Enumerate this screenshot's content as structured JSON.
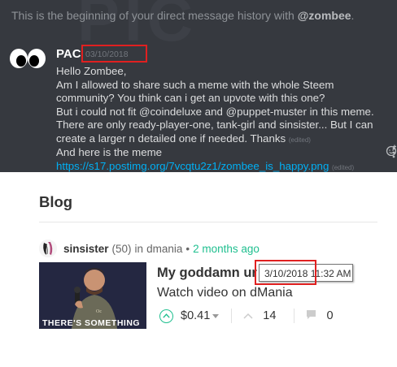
{
  "chat": {
    "intro_prefix": "This is the beginning of your direct message history with ",
    "intro_user": "@zombee",
    "intro_suffix": ".",
    "background_text": "PIC",
    "author": "PAC",
    "timestamp": "03/10/2018",
    "message_lines": [
      "Hello Zombee,",
      "Am I allowed to share such a meme with the whole Steem",
      "community? You think can i get an upvote with this one?",
      "But i could not fit @coindeluxe and @puppet-muster in this meme.",
      "There are only ready-player-one, tank-girl and sinsister... But I can",
      "create a larger n detailed one if needed. Thanks "
    ],
    "edited_label": "(edited)",
    "message2_text": "And here is the meme",
    "link": "https://s17.postimg.org/7vcqtu2z1/zombee_is_happy.png",
    "edited_label_2": "(edited)"
  },
  "blog": {
    "heading": "Blog",
    "post": {
      "author": "sinsister",
      "reputation": "(50)",
      "in_word": "in",
      "category": "dmania",
      "separator": "•",
      "time_ago": "2 months ago",
      "title": "My goddamn ur",
      "body": "Watch video on dMania",
      "thumbnail_caption": "THERE'S SOMETHING",
      "payout": "$0.41",
      "votes": "14",
      "comments": "0"
    },
    "tooltip": "3/10/2018 11:32 AM"
  },
  "colors": {
    "chat_bg": "#36393f",
    "link": "#00b0f4",
    "highlight": "#e02020",
    "steem_green": "#1fbf8f"
  },
  "icons": [
    "emoji-add-icon",
    "more-icon",
    "upvote-icon",
    "caret-down-icon",
    "votes-icon",
    "comment-icon"
  ]
}
